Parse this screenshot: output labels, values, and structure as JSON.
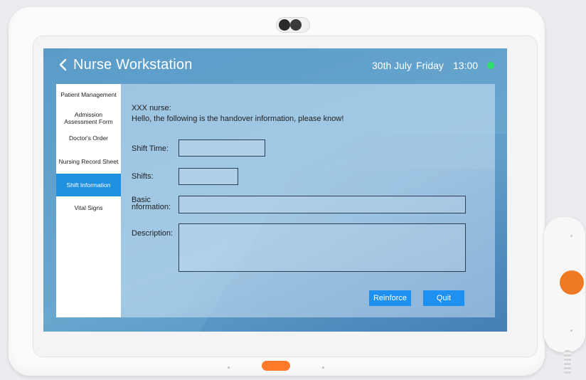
{
  "header": {
    "title": "Nurse Workstation",
    "date": "30th July",
    "weekday": "Friday",
    "time": "13:00"
  },
  "sidebar": {
    "items": [
      {
        "label": "Patient Management",
        "active": false
      },
      {
        "label": "Admission Assessment Form",
        "active": false
      },
      {
        "label": "Doctor's Order",
        "active": false
      },
      {
        "label": "Nursing Record Sheet",
        "active": false
      },
      {
        "label": "Shift Information",
        "active": true
      },
      {
        "label": "Vital Signs",
        "active": false
      }
    ]
  },
  "main": {
    "greeting": "XXX nurse:",
    "message": "Hello, the following is the handover information, please know!",
    "fields": {
      "shift_time_label": "Shift Time:",
      "shifts_label": "Shifts:",
      "basic_label_1": "Basic",
      "basic_label_2": "nformation:",
      "description_label": "Description:"
    },
    "buttons": {
      "reinforce": "Reinforce",
      "quit": "Quit"
    }
  },
  "colors": {
    "accent": "#1e90f0",
    "screen": "#5a9bc8",
    "status": "#2ee06a",
    "device_button": "#ff7a2a"
  },
  "icons": {
    "back": "chevron-left-icon",
    "camera": "camera-icon"
  }
}
